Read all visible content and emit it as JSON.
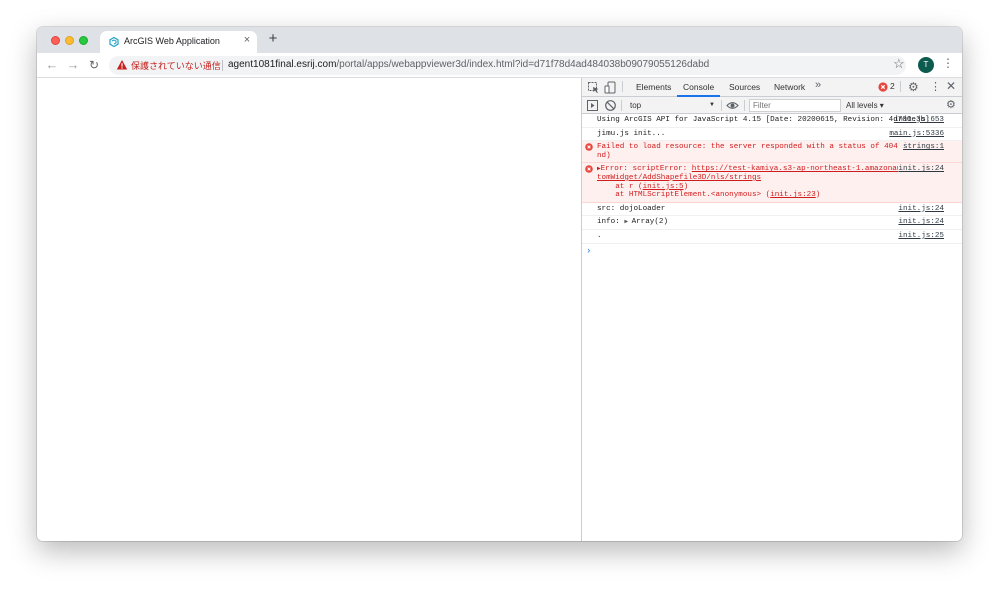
{
  "browser": {
    "tab_title": "ArcGIS Web Application",
    "tab_close": "×",
    "new_tab": "+",
    "security_label": "保護されていない通信",
    "url_host": "agent1081final.esrij.com",
    "url_path": "/portal/apps/webappviewer3d/index.html?id=d71f78d4ad484038b09079055126dabd",
    "avatar_initial": "T",
    "colors": {
      "avatar": "#0d5b4f",
      "insecure": "#c5221f",
      "favicon": "#1da1c6"
    }
  },
  "devtools": {
    "tabs": [
      {
        "label": "Elements"
      },
      {
        "label": "Console"
      },
      {
        "label": "Sources"
      },
      {
        "label": "Network"
      }
    ],
    "more_tabs": "»",
    "error_count": "2",
    "context_select": "top",
    "filter_placeholder": "Filter",
    "levels": "All levels ▾",
    "messages": [
      {
        "text": "Using ArcGIS API for JavaScript 4.15 [Date: 20200615, Revision: 4d700e3b]",
        "source": "init.js:653"
      },
      {
        "text": "jimu.js init...",
        "source": "main.js:5336"
      },
      {
        "text": "Failed to load resource: the server responded with a status of 404 (Not Found)",
        "source": "strings:1"
      },
      {
        "prefix": "Error: scriptError: ",
        "link": "https://test-kamiya.s3-ap-northeast-1.amazonaws.com/customWidget/AddShapefile3D/nls/strings",
        "stack1_pre": "    at r (",
        "stack1_link": "init.js:5",
        "stack1_post": ")",
        "stack2_pre": "    at HTMLScriptElement.<anonymous> (",
        "stack2_link": "init.js:23",
        "stack2_post": ")",
        "source": "init.js:24"
      },
      {
        "text": "src: dojoLoader",
        "source": "init.js:24"
      },
      {
        "text": "info: ",
        "value": "Array(2)",
        "source": "init.js:24"
      },
      {
        "text": ".",
        "source": "init.js:25"
      }
    ],
    "prompt": "›"
  }
}
